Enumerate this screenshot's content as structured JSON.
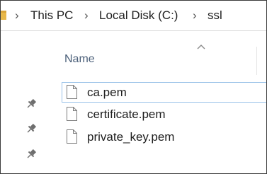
{
  "address_bar": {
    "breadcrumbs": [
      {
        "label": "This PC"
      },
      {
        "label": "Local Disk (C:)"
      },
      {
        "label": "ssl"
      }
    ],
    "separator_icon": "chevron-right-icon"
  },
  "file_list": {
    "column_header": "Name",
    "sort_direction": "ascending",
    "files": [
      {
        "name": "ca.pem",
        "icon": "file-icon",
        "selected": true
      },
      {
        "name": "certificate.pem",
        "icon": "file-icon",
        "selected": false
      },
      {
        "name": "private_key.pem",
        "icon": "file-icon",
        "selected": false
      }
    ]
  },
  "quick_access": {
    "pins": [
      "pin-icon",
      "pin-icon",
      "pin-icon"
    ]
  },
  "colors": {
    "header_text": "#4c607a",
    "selection_border": "#99c1e8",
    "folder": "#e8b84a"
  }
}
